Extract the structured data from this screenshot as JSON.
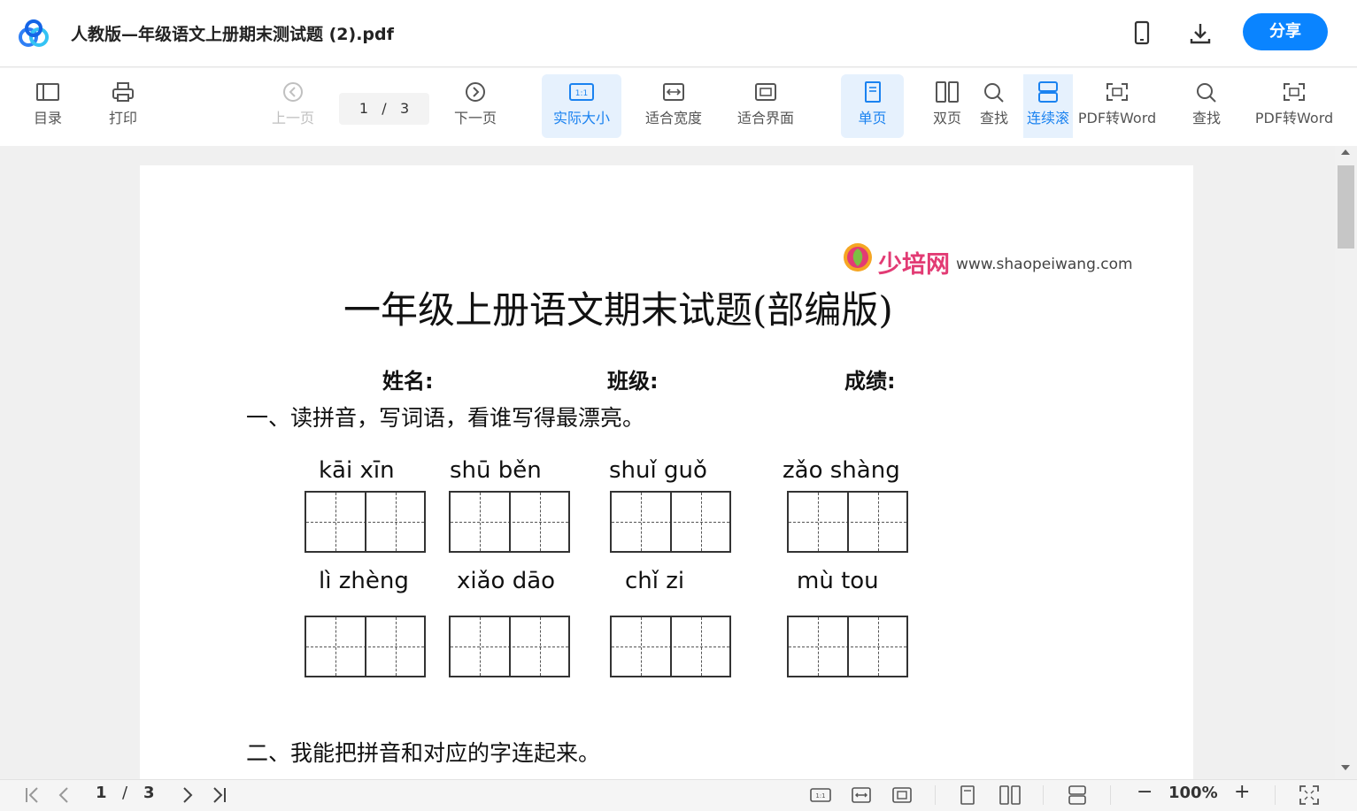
{
  "app": {
    "title": "人教版—年级语文上册期末测试题 (2).pdf",
    "share_label": "分享",
    "accent_color": "#1a82f0"
  },
  "toolbar": {
    "items": [
      {
        "label": "目录",
        "icon": "outline-icon"
      },
      {
        "label": "打印",
        "icon": "print-icon"
      },
      {
        "label": "上一页",
        "icon": "prev-page-icon",
        "disabled": true
      },
      {
        "label": "下一页",
        "icon": "next-page-icon"
      },
      {
        "label": "实际大小",
        "icon": "actual-size-icon",
        "active": true
      },
      {
        "label": "适合宽度",
        "icon": "fit-width-icon"
      },
      {
        "label": "适合界面",
        "icon": "fit-page-icon"
      },
      {
        "label": "单页",
        "icon": "single-page-icon",
        "active": true
      },
      {
        "label": "双页",
        "icon": "double-page-icon"
      },
      {
        "label": "查找",
        "icon": "search-icon"
      },
      {
        "label": "连续滚",
        "icon": "continuous-scroll-icon",
        "active": true
      },
      {
        "label": "PDF转Word",
        "icon": "pdf-to-word-icon"
      },
      {
        "label": "查找",
        "icon": "search-icon"
      },
      {
        "label": "PDF转Word",
        "icon": "pdf-to-word-icon"
      }
    ],
    "page_current": "1",
    "page_sep": "/",
    "page_total": "3",
    "actual_size_glyph": "1:1"
  },
  "document": {
    "brand_cn": "少培网",
    "brand_url": "www.shaopeiwang.com",
    "title": "一年级上册语文期末试题(部编版)",
    "fields": {
      "name": "姓名:",
      "class": "班级:",
      "score": "成绩:"
    },
    "section1": "一、读拼音，写词语，看谁写得最漂亮。",
    "section2": "二、我能把拼音和对应的字连起来。",
    "pinyin_row1": [
      "kāi xīn",
      "shū  běn",
      "shuǐ  guǒ",
      "zǎo shàng"
    ],
    "pinyin_row2": [
      "lì  zhèng",
      "xiǎo  dāo",
      "chǐ   zi",
      "mù   tou"
    ]
  },
  "bottom": {
    "page_current": "1",
    "page_sep": "/",
    "page_total": "3",
    "zoom": "100%",
    "minus": "−",
    "plus": "+"
  }
}
